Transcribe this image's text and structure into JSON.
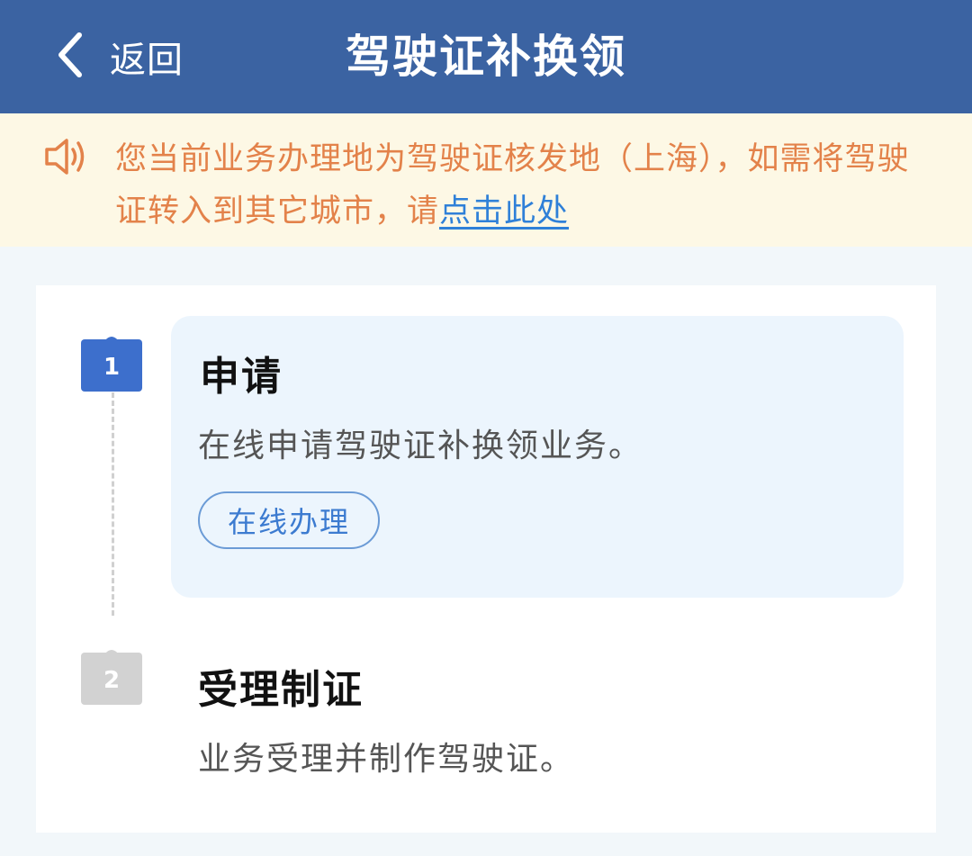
{
  "header": {
    "back_label": "返回",
    "title": "驾驶证补换领",
    "back_icon": "chevron-left-icon",
    "background": "#3b63a2"
  },
  "notice": {
    "icon": "speaker-icon",
    "text": "您当前业务办理地为驾驶证核发地（上海），如需将驾驶证转入到其它城市，请",
    "link_text": "点击此处",
    "text_color": "#e3824a",
    "link_color": "#2f80d8"
  },
  "steps": [
    {
      "number": "1",
      "title": "申请",
      "description": "在线申请驾驶证补换领业务。",
      "action_label": "在线办理",
      "badge_color": "#3d6fcc",
      "status": "active"
    },
    {
      "number": "2",
      "title": "受理制证",
      "description": "业务受理并制作驾驶证。",
      "badge_color": "#d2d2d2",
      "status": "inactive"
    }
  ]
}
